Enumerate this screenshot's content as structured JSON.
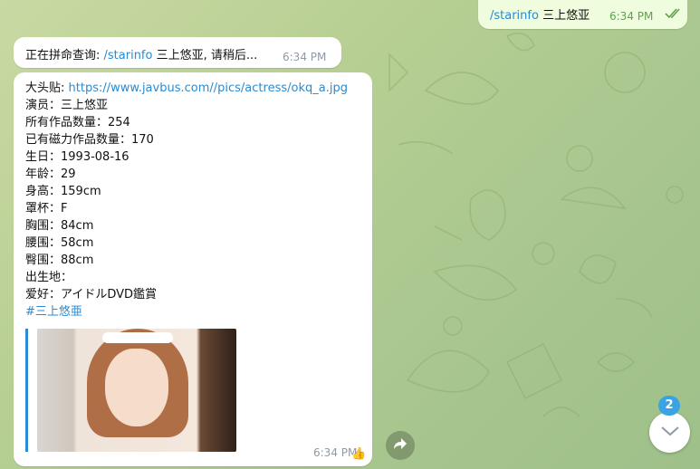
{
  "outgoing": {
    "command": "/starinfo",
    "query": " 三上悠亚",
    "time": "6:34 PM"
  },
  "search_message": {
    "prefix": "正在拼命查询: ",
    "command": "/starinfo",
    "suffix": " 三上悠亚, 请稍后...",
    "time": "6:34 PM"
  },
  "info_message": {
    "avatar_label": "大头贴: ",
    "avatar_url": "https://www.javbus.com//pics/actress/okq_a.jpg",
    "lines": [
      "演员：三上悠亚",
      "所有作品数量：254",
      "已有磁力作品数量：170",
      "生日：1993-08-16",
      "年龄：29",
      "身高：159cm",
      "罩杯：F",
      "胸围：84cm",
      "腰围：58cm",
      "臀围：88cm",
      "出生地：",
      "爱好：アイドルDVD鑑賞"
    ],
    "hashtag": "#三上悠亜",
    "time": "6:34 PM",
    "reaction": "👍"
  },
  "scroll_down": {
    "unread_count": "2"
  },
  "colors": {
    "link": "#2a8bd0",
    "outgoing_bubble": "#effdde",
    "badge": "#3aa3e3"
  }
}
